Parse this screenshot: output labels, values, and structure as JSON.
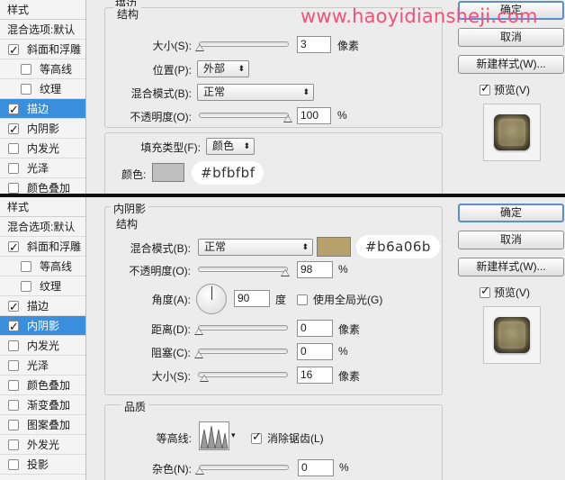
{
  "watermark": "www.haoyidiansheji.com",
  "top": {
    "section_title": "描边",
    "style_list": {
      "header": "样式",
      "items": [
        {
          "label": "混合选项:默认",
          "check": null,
          "sub": false,
          "selected": false
        },
        {
          "label": "斜面和浮雕",
          "check": true,
          "sub": false,
          "selected": false
        },
        {
          "label": "等高线",
          "check": false,
          "sub": true,
          "selected": false
        },
        {
          "label": "纹理",
          "check": false,
          "sub": true,
          "selected": false
        },
        {
          "label": "描边",
          "check": true,
          "sub": false,
          "selected": true
        },
        {
          "label": "内阴影",
          "check": true,
          "sub": false,
          "selected": false
        },
        {
          "label": "内发光",
          "check": false,
          "sub": false,
          "selected": false
        },
        {
          "label": "光泽",
          "check": false,
          "sub": false,
          "selected": false
        },
        {
          "label": "颜色叠加",
          "check": false,
          "sub": false,
          "selected": false
        }
      ]
    },
    "structure": {
      "legend": "结构",
      "size_label": "大小(S):",
      "size_value": "3",
      "size_unit": "像素",
      "position_label": "位置(P):",
      "position_value": "外部",
      "blend_label": "混合模式(B):",
      "blend_value": "正常",
      "opacity_label": "不透明度(O):",
      "opacity_value": "100",
      "opacity_unit": "%",
      "size_level": 0.0,
      "opacity_level": 1.0
    },
    "fill": {
      "type_label": "填充类型(F):",
      "type_value": "颜色",
      "color_label": "颜色:",
      "color_hex": "#bfbfbf",
      "color_display": "#bfbfbf"
    },
    "buttons": {
      "ok": "确定",
      "cancel": "取消",
      "new_style": "新建样式(W)...",
      "preview": "预览(V)"
    }
  },
  "bottom": {
    "section_title": "内阴影",
    "style_list": {
      "header": "样式",
      "items": [
        {
          "label": "混合选项:默认",
          "check": null,
          "sub": false,
          "selected": false
        },
        {
          "label": "斜面和浮雕",
          "check": true,
          "sub": false,
          "selected": false
        },
        {
          "label": "等高线",
          "check": false,
          "sub": true,
          "selected": false
        },
        {
          "label": "纹理",
          "check": false,
          "sub": true,
          "selected": false
        },
        {
          "label": "描边",
          "check": true,
          "sub": false,
          "selected": false
        },
        {
          "label": "内阴影",
          "check": true,
          "sub": false,
          "selected": true
        },
        {
          "label": "内发光",
          "check": false,
          "sub": false,
          "selected": false
        },
        {
          "label": "光泽",
          "check": false,
          "sub": false,
          "selected": false
        },
        {
          "label": "颜色叠加",
          "check": false,
          "sub": false,
          "selected": false
        },
        {
          "label": "渐变叠加",
          "check": false,
          "sub": false,
          "selected": false
        },
        {
          "label": "图案叠加",
          "check": false,
          "sub": false,
          "selected": false
        },
        {
          "label": "外发光",
          "check": false,
          "sub": false,
          "selected": false
        },
        {
          "label": "投影",
          "check": false,
          "sub": false,
          "selected": false
        }
      ]
    },
    "structure": {
      "legend": "结构",
      "blend_label": "混合模式(B):",
      "blend_value": "正常",
      "color_hex": "#b6a06b",
      "color_display": "#b6a06b",
      "opacity_label": "不透明度(O):",
      "opacity_value": "98",
      "opacity_unit": "%",
      "opacity_level": 0.98,
      "angle_label": "角度(A):",
      "angle_value": "90",
      "angle_unit": "度",
      "global_light_label": "使用全局光(G)",
      "global_light": false,
      "distance_label": "距离(D):",
      "distance_value": "0",
      "distance_unit": "像素",
      "distance_level": 0.0,
      "choke_label": "阻塞(C):",
      "choke_value": "0",
      "choke_unit": "%",
      "choke_level": 0.0,
      "size_label": "大小(S):",
      "size_value": "16",
      "size_unit": "像素",
      "size_level": 0.06
    },
    "quality": {
      "legend": "品质",
      "contour_label": "等高线:",
      "antialias_label": "消除锯齿(L)",
      "antialias": true,
      "noise_label": "杂色(N):",
      "noise_value": "0",
      "noise_unit": "%",
      "noise_level": 0.0
    },
    "buttons": {
      "ok": "确定",
      "cancel": "取消",
      "new_style": "新建样式(W)...",
      "preview": "预览(V)"
    }
  }
}
